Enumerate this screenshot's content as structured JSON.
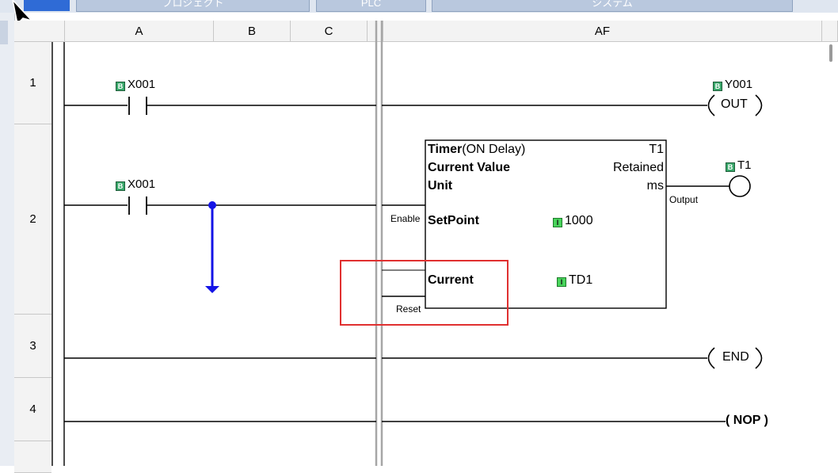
{
  "menu_tabs": [
    {
      "label": "プロジェクト"
    },
    {
      "label": "PLC"
    },
    {
      "label": "システム"
    }
  ],
  "columns": [
    "A",
    "B",
    "C",
    "AF"
  ],
  "rows": [
    "1",
    "2",
    "3",
    "4"
  ],
  "rung1": {
    "contact_label": "X001",
    "coil_label": "Y001",
    "coil_text": "OUT"
  },
  "rung2": {
    "contact_label": "X001",
    "timer": {
      "title": "Timer",
      "mode": "(ON Delay)",
      "id": "T1",
      "current_value_label": "Current Value",
      "current_value": "Retained",
      "unit_label": "Unit",
      "unit": "ms",
      "setpoint_label": "SetPoint",
      "setpoint_value": "1000",
      "current_label": "Current",
      "current_device": "TD1",
      "enable_pin": "Enable",
      "reset_pin": "Reset",
      "output_pin": "Output"
    },
    "output_coil_label": "T1"
  },
  "rung3": {
    "instruction": "END"
  },
  "rung4": {
    "instruction": "( NOP )"
  },
  "colors": {
    "connector": "#1414e6",
    "highlight_box": "#e03030",
    "header_bg": "#f3f3f3",
    "device_badge": "#3aa86b"
  }
}
